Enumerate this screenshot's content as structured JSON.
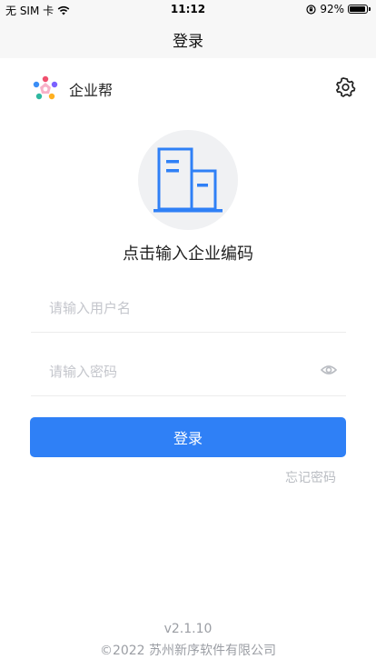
{
  "status_bar": {
    "carrier": "无 SIM 卡",
    "time": "11:12",
    "battery_percent": "92%",
    "battery_level": 0.92,
    "icons": [
      "wifi-icon",
      "orientation-lock-icon",
      "battery-icon"
    ]
  },
  "nav": {
    "title": "登录"
  },
  "header": {
    "brand_name": "企业帮",
    "logo_icon": "brand-logo-icon",
    "settings_icon": "gear-icon"
  },
  "company": {
    "icon": "building-icon",
    "prompt": "点击输入企业编码"
  },
  "form": {
    "username_placeholder": "请输入用户名",
    "username_value": "",
    "password_placeholder": "请输入密码",
    "password_value": "",
    "password_toggle_icon": "eye-icon",
    "login_label": "登录",
    "forgot_label": "忘记密码"
  },
  "footer": {
    "version": "v2.1.10",
    "copyright": "©2022 苏州新序软件有限公司"
  },
  "colors": {
    "accent": "#2f80f6",
    "placeholder": "#c4c6cc",
    "muted": "#9b9ea4",
    "bar_bg": "#f7f7f7"
  }
}
